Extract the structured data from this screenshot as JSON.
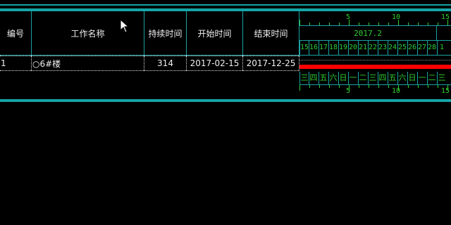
{
  "table": {
    "headers": [
      "编号",
      "工作名称",
      "持续时间",
      "开始时间",
      "结束时间"
    ],
    "rows": [
      {
        "id": "1",
        "name": "○6#楼",
        "duration": "314",
        "start": "2017-02-15",
        "end": "2017-12-25"
      }
    ]
  },
  "gantt": {
    "scale_top": [
      "5",
      "10",
      "15"
    ],
    "month_label": "2017.2",
    "days": [
      "15",
      "16",
      "17",
      "18",
      "19",
      "20",
      "21",
      "22",
      "23",
      "24",
      "25",
      "26",
      "27",
      "28",
      "1"
    ],
    "weekdays": [
      "三",
      "四",
      "五",
      "六",
      "日",
      "一",
      "二",
      "三",
      "四",
      "五",
      "六",
      "日",
      "一",
      "二",
      "三"
    ],
    "scale_bottom": [
      "5",
      "10",
      "15"
    ],
    "bar_color": "#ff0000"
  },
  "colors": {
    "accent": "#14a5a6",
    "grid_text": "#2fd12f",
    "bar": "#ff0000"
  }
}
